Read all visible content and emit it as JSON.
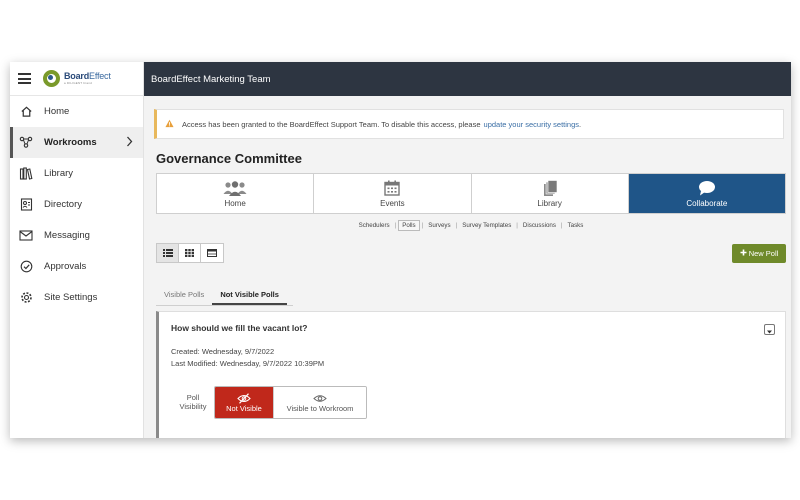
{
  "app": {
    "logo_main_a": "Board",
    "logo_main_b": "Effect",
    "logo_sub": "a DILIGENT brand"
  },
  "sidebar": {
    "items": [
      {
        "label": "Home",
        "icon": "home-icon"
      },
      {
        "label": "Workrooms",
        "icon": "workrooms-icon"
      },
      {
        "label": "Library",
        "icon": "library-icon"
      },
      {
        "label": "Directory",
        "icon": "directory-icon"
      },
      {
        "label": "Messaging",
        "icon": "envelope-icon"
      },
      {
        "label": "Approvals",
        "icon": "check-circle-icon"
      },
      {
        "label": "Site Settings",
        "icon": "gear-icon"
      }
    ],
    "active": "Workrooms"
  },
  "header": {
    "title": "BoardEffect Marketing Team"
  },
  "alert": {
    "text": "Access has been granted to the BoardEffect Support Team. To disable this access, please",
    "link": "update your security settings",
    "suffix": ".",
    "color": "#e8b85c"
  },
  "workroom": {
    "title": "Governance Committee",
    "tiles": [
      {
        "label": "Home",
        "icon": "people-icon"
      },
      {
        "label": "Events",
        "icon": "calendar-icon"
      },
      {
        "label": "Library",
        "icon": "books-icon"
      },
      {
        "label": "Collaborate",
        "icon": "chat-bubble-icon"
      }
    ],
    "active_tile": "Collaborate",
    "active_color": "#1f5588"
  },
  "subnav": {
    "items": [
      "Schedulers",
      "Polls",
      "Surveys",
      "Survey Templates",
      "Discussions",
      "Tasks"
    ],
    "active": "Polls"
  },
  "toolbar": {
    "views": [
      "list-view-icon",
      "grid-view-icon",
      "table-view-icon"
    ],
    "new_poll_label": "New Poll",
    "new_poll_color": "#6f8a2a"
  },
  "tabs": {
    "items": [
      "Visible Polls",
      "Not Visible Polls"
    ],
    "active": "Not Visible Polls"
  },
  "poll": {
    "question": "How should we fill the vacant lot?",
    "created": "Created: Wednesday, 9/7/2022",
    "modified": "Last Modified: Wednesday, 9/7/2022 10:39PM",
    "visibility_label_line1": "Poll",
    "visibility_label_line2": "Visibility",
    "options": [
      "Not Visible",
      "Visible to Workroom"
    ],
    "selected": "Not Visible",
    "selected_color": "#c0281b"
  }
}
